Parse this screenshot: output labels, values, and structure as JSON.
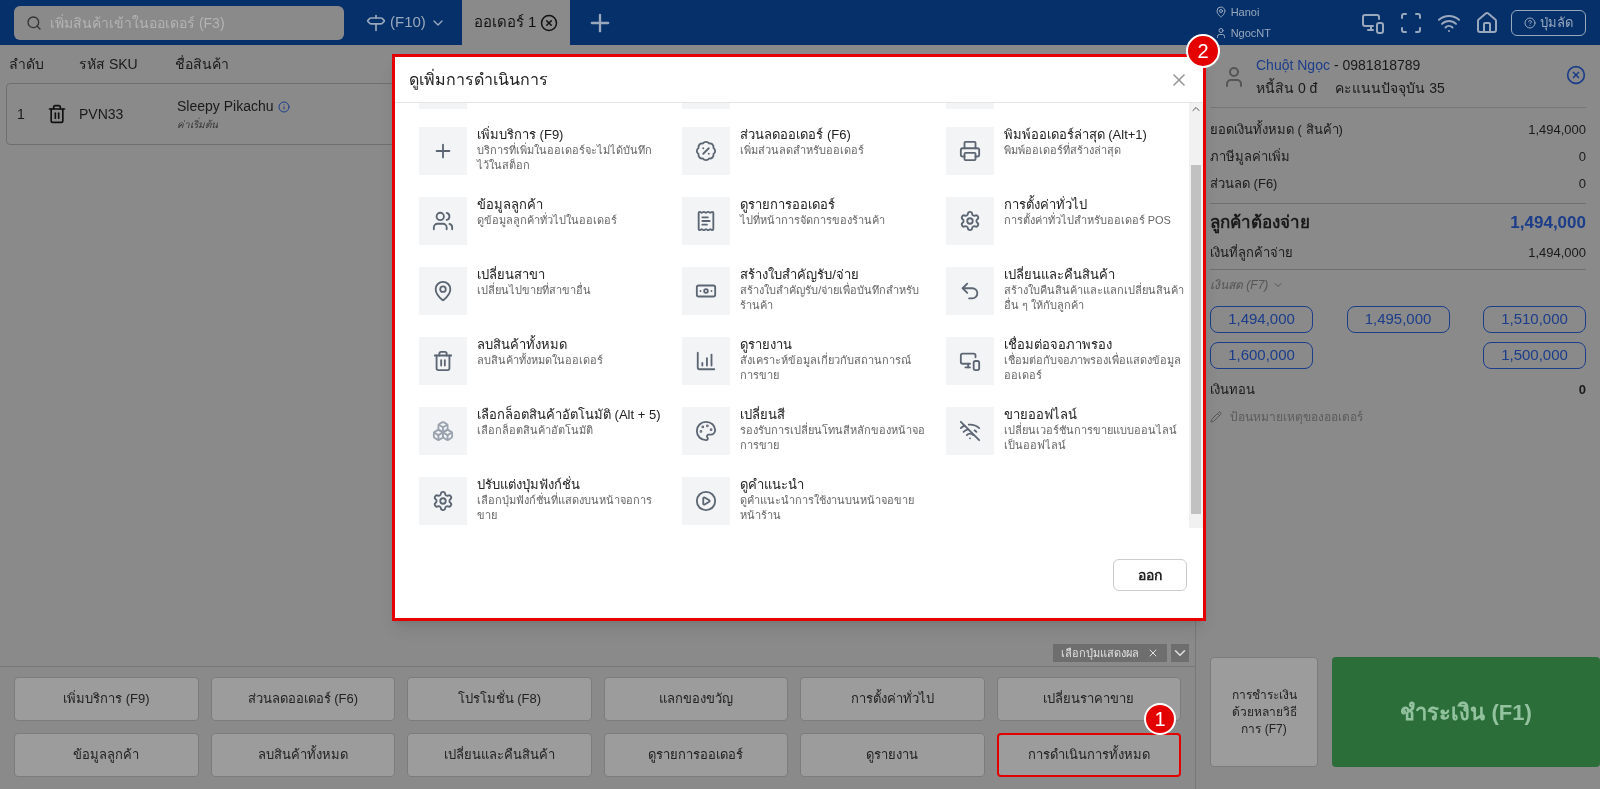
{
  "top_bar": {
    "search": {
      "placeholder": "เพิ่มสินค้าเข้าในออเดอร์ (F3)"
    },
    "price_list": "(F10)",
    "tabs": [
      {
        "label": "ออเดอร์ 1",
        "selected": true
      }
    ],
    "location": "Hanoi",
    "user": "NgocNT",
    "shortcut_button": "ปุ่มลัด"
  },
  "table": {
    "columns": [
      "ลำดับ",
      "รหัส SKU",
      "ชื่อสินค้า"
    ],
    "rows": [
      {
        "index": "1",
        "sku": "PVN33",
        "name": "Sleepy Pikachu",
        "variant": "ค่าเริ่มต้น"
      }
    ]
  },
  "display_toggle": "เลือกปุ่มแสดงผล",
  "function_buttons": [
    {
      "label": "เพิ่มบริการ (F9)",
      "highlighted": false
    },
    {
      "label": "ส่วนลดออเดอร์ (F6)",
      "highlighted": false
    },
    {
      "label": "โปรโมชั่น (F8)",
      "highlighted": false
    },
    {
      "label": "แลกของขวัญ",
      "highlighted": false
    },
    {
      "label": "การตั้งค่าทั่วไป",
      "highlighted": false
    },
    {
      "label": "เปลี่ยนราคาขาย",
      "highlighted": false
    },
    {
      "label": "ข้อมูลลูกค้า",
      "highlighted": false
    },
    {
      "label": "ลบสินค้าทั้งหมด",
      "highlighted": false
    },
    {
      "label": "เปลี่ยนและคืนสินค้า",
      "highlighted": false
    },
    {
      "label": "ดูรายการออเดอร์",
      "highlighted": false
    },
    {
      "label": "ดูรายงาน",
      "highlighted": false
    },
    {
      "label": "การดำเนินการทั้งหมด",
      "highlighted": true
    }
  ],
  "customer": {
    "name": "Chuột Ngọc",
    "phone": "- 0981818789",
    "debt": "หนี้สิน 0 đ",
    "points": "คะแนนปัจจุบัน 35"
  },
  "summary": [
    {
      "kind": "row",
      "label": "ยอดเงินทั้งหมด ( สินค้า)",
      "value": "1,494,000"
    },
    {
      "kind": "row",
      "label": "ภาษีมูลค่าเพิ่ม",
      "value": "0"
    },
    {
      "kind": "row",
      "label": "ส่วนลด (F6)",
      "value": "0"
    },
    {
      "kind": "total",
      "label": "ลูกค้าต้องจ่าย",
      "value": "1,494,000"
    },
    {
      "kind": "row",
      "label": "เงินที่ลูกค้าจ่าย",
      "value": "1,494,000"
    }
  ],
  "payment_method": "เงินสด (F7)",
  "cash_amounts": [
    "1,494,000",
    "1,495,000",
    "1,510,000",
    "1,600,000",
    "1,500,000"
  ],
  "change": {
    "label": "เงินทอน",
    "value": "0"
  },
  "note": {
    "placeholder": "ป้อนหมายเหตุของออเดอร์"
  },
  "multi_payment_button": "การชำระเงินด้วยหลายวิธีการ (F7)",
  "pay_button": "ชำระเงิน (F1)",
  "modal": {
    "title": "ดูเพิ่มการดำเนินการ",
    "close_button": "ออก",
    "actions": [
      {
        "title": "เพิ่มบริการ (F9)",
        "description": "บริการที่เพิ่มในออเดอร์จะไม่ได้บันทึกไว้ในสต็อก"
      },
      {
        "title": "ส่วนลดออเดอร์ (F6)",
        "description": "เพิ่มส่วนลดสำหรับออเดอร์"
      },
      {
        "title": "พิมพ์ออเดอร์ล่าสุด (Alt+1)",
        "description": "พิมพ์ออเดอร์ที่สร้างล่าสุด"
      },
      {
        "title": "ข้อมูลลูกค้า",
        "description": "ดูข้อมูลลูกค้าทั่วไปในออเดอร์"
      },
      {
        "title": "ดูรายการออเดอร์",
        "description": "ไปที่หน้าการจัดการของร้านค้า"
      },
      {
        "title": "การตั้งค่าทั่วไป",
        "description": "การตั้งค่าทั่วไปสำหรับออเดอร์ POS"
      },
      {
        "title": "เปลี่ยนสาขา",
        "description": "เปลี่ยนไปขายที่สาขาอื่น"
      },
      {
        "title": "สร้างใบสำคัญรับ/จ่าย",
        "description": "สร้างใบสำคัญรับ/จ่ายเพื่อบันทึกสำหรับร้านค้า"
      },
      {
        "title": "เปลี่ยนและคืนสินค้า",
        "description": "สร้างใบคืนสินค้าและแลกเปลี่ยนสินค้าอื่น ๆ ให้กับลูกค้า"
      },
      {
        "title": "ลบสินค้าทั้งหมด",
        "description": "ลบสินค้าทั้งหมดในออเดอร์"
      },
      {
        "title": "ดูรายงาน",
        "description": "สังเคราะห์ข้อมูลเกี่ยวกับสถานการณ์การขาย"
      },
      {
        "title": "เชื่อมต่อจอภาพรอง",
        "description": "เชื่อมต่อกับจอภาพรองเพื่อแสดงข้อมูลออเดอร์"
      },
      {
        "title": "เลือกล็อตสินค้าอัตโนมัติ (Alt + 5)",
        "description": "เลือกล็อตสินค้าอัตโนมัติ"
      },
      {
        "title": "เปลี่ยนสี",
        "description": "รองรับการเปลี่ยนโทนสีหลักของหน้าจอการขาย"
      },
      {
        "title": "ขายออฟไลน์",
        "description": "เปลี่ยนเวอร์ชันการขายแบบออนไลน์เป็นออฟไลน์"
      },
      {
        "title": "ปรับแต่งปุ่มฟังก์ชั่น",
        "description": "เลือกปุ่มฟังก์ชั่นที่แสดงบนหน้าจอการขาย"
      },
      {
        "title": "ดูคำแนะนำ",
        "description": "ดูคำแนะนำการใช้งานบนหน้าจอขายหน้าร้าน"
      }
    ]
  },
  "annotations": [
    {
      "number": "1"
    },
    {
      "number": "2"
    }
  ]
}
